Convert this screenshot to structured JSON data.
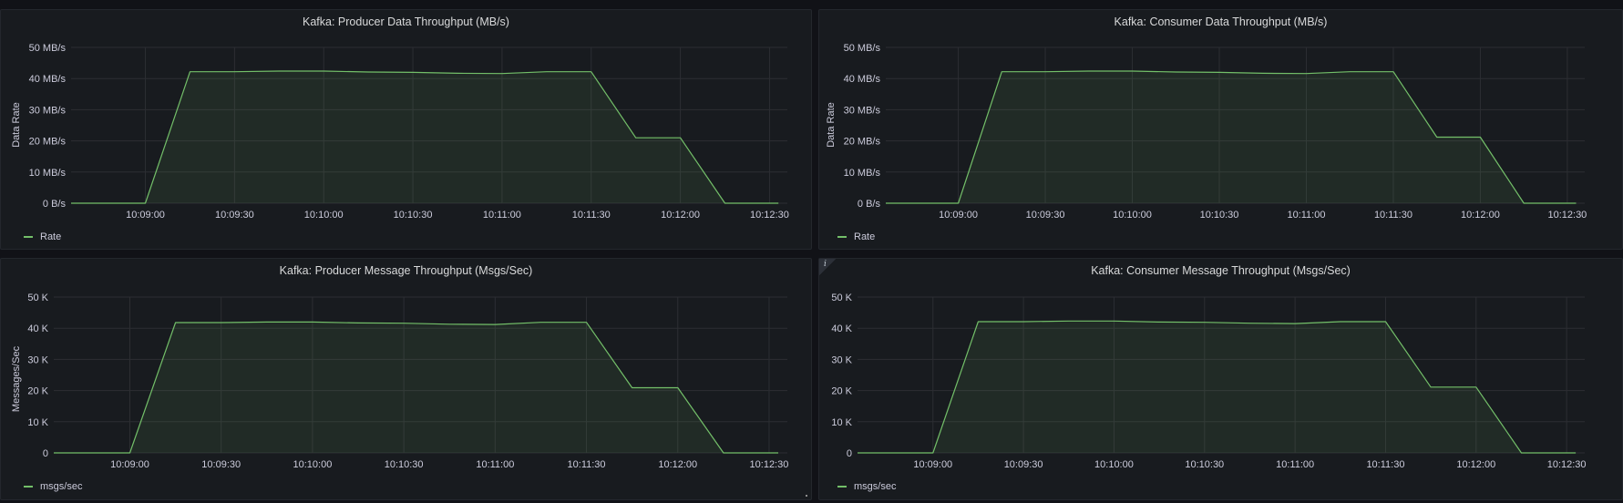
{
  "colors": {
    "series": "#73bf69",
    "fill": "rgba(115,191,105,0.10)",
    "grid": "#2c2e33"
  },
  "panels": [
    {
      "id": "producer-data",
      "title": "Kafka: Producer Data Throughput (MB/s)",
      "ylabel": "Data Rate",
      "legend": "Rate",
      "info_icon": false
    },
    {
      "id": "consumer-data",
      "title": "Kafka: Consumer Data Throughput (MB/s)",
      "ylabel": "Data Rate",
      "legend": "Rate",
      "info_icon": false
    },
    {
      "id": "producer-msgs",
      "title": "Kafka: Producer Message Throughput (Msgs/Sec)",
      "ylabel": "Messages/Sec",
      "legend": "msgs/sec",
      "info_icon": false
    },
    {
      "id": "consumer-msgs",
      "title": "Kafka: Consumer Message Throughput (Msgs/Sec)",
      "ylabel": "",
      "legend": "msgs/sec",
      "info_icon": true,
      "info_label": "i"
    }
  ],
  "chart_data": [
    {
      "type": "area",
      "title": "Kafka: Producer Data Throughput (MB/s)",
      "xlabel": "",
      "ylabel": "Data Rate",
      "x_ticks": [
        "10:09:00",
        "10:09:30",
        "10:10:00",
        "10:10:30",
        "10:11:00",
        "10:11:30",
        "10:12:00",
        "10:12:30"
      ],
      "y_ticks": [
        "0 B/s",
        "10 MB/s",
        "20 MB/s",
        "30 MB/s",
        "40 MB/s",
        "50 MB/s"
      ],
      "ylim": [
        0,
        50
      ],
      "xlim": [
        "10:08:35",
        "10:12:36"
      ],
      "grid": true,
      "legend_position": "bottom-left",
      "series": [
        {
          "name": "Rate",
          "x": [
            "10:08:35",
            "10:08:45",
            "10:08:55",
            "10:09:00",
            "10:09:15",
            "10:09:30",
            "10:09:45",
            "10:10:00",
            "10:10:15",
            "10:10:30",
            "10:10:45",
            "10:11:00",
            "10:11:15",
            "10:11:30",
            "10:11:45",
            "10:12:00",
            "10:12:15",
            "10:12:30",
            "10:12:33"
          ],
          "y": [
            0,
            0,
            0,
            0,
            42.2,
            42.2,
            42.4,
            42.4,
            42.1,
            42.0,
            41.7,
            41.6,
            42.2,
            42.2,
            21.0,
            21.0,
            0,
            0,
            0
          ]
        }
      ]
    },
    {
      "type": "area",
      "title": "Kafka: Consumer Data Throughput (MB/s)",
      "xlabel": "",
      "ylabel": "Data Rate",
      "x_ticks": [
        "10:09:00",
        "10:09:30",
        "10:10:00",
        "10:10:30",
        "10:11:00",
        "10:11:30",
        "10:12:00",
        "10:12:30"
      ],
      "y_ticks": [
        "0 B/s",
        "10 MB/s",
        "20 MB/s",
        "30 MB/s",
        "40 MB/s",
        "50 MB/s"
      ],
      "ylim": [
        0,
        50
      ],
      "xlim": [
        "10:08:35",
        "10:12:36"
      ],
      "grid": true,
      "legend_position": "bottom-left",
      "series": [
        {
          "name": "Rate",
          "x": [
            "10:08:35",
            "10:08:45",
            "10:08:55",
            "10:09:00",
            "10:09:15",
            "10:09:30",
            "10:09:45",
            "10:10:00",
            "10:10:15",
            "10:10:30",
            "10:10:45",
            "10:11:00",
            "10:11:15",
            "10:11:30",
            "10:11:45",
            "10:12:00",
            "10:12:15",
            "10:12:30",
            "10:12:33"
          ],
          "y": [
            0,
            0,
            0,
            0,
            42.2,
            42.2,
            42.4,
            42.4,
            42.1,
            42.0,
            41.7,
            41.6,
            42.2,
            42.2,
            21.2,
            21.2,
            0,
            0,
            0
          ]
        }
      ]
    },
    {
      "type": "area",
      "title": "Kafka: Producer Message Throughput (Msgs/Sec)",
      "xlabel": "",
      "ylabel": "Messages/Sec",
      "x_ticks": [
        "10:09:00",
        "10:09:30",
        "10:10:00",
        "10:10:30",
        "10:11:00",
        "10:11:30",
        "10:12:00",
        "10:12:30"
      ],
      "y_ticks": [
        "0",
        "10 K",
        "20 K",
        "30 K",
        "40 K",
        "50 K"
      ],
      "ylim": [
        0,
        50
      ],
      "xlim": [
        "10:08:35",
        "10:12:36"
      ],
      "grid": true,
      "legend_position": "bottom-left",
      "series": [
        {
          "name": "msgs/sec",
          "x": [
            "10:08:35",
            "10:08:45",
            "10:08:55",
            "10:09:00",
            "10:09:15",
            "10:09:30",
            "10:09:45",
            "10:10:00",
            "10:10:15",
            "10:10:30",
            "10:10:45",
            "10:11:00",
            "10:11:15",
            "10:11:30",
            "10:11:45",
            "10:12:00",
            "10:12:15",
            "10:12:30",
            "10:12:33"
          ],
          "y": [
            0,
            0,
            0,
            0,
            41.8,
            41.8,
            42.0,
            42.0,
            41.7,
            41.6,
            41.3,
            41.2,
            41.9,
            41.9,
            20.9,
            20.9,
            0,
            0,
            0
          ]
        }
      ]
    },
    {
      "type": "area",
      "title": "Kafka: Consumer Message Throughput (Msgs/Sec)",
      "xlabel": "",
      "ylabel": "",
      "x_ticks": [
        "10:09:00",
        "10:09:30",
        "10:10:00",
        "10:10:30",
        "10:11:00",
        "10:11:30",
        "10:12:00",
        "10:12:30"
      ],
      "y_ticks": [
        "0",
        "10 K",
        "20 K",
        "30 K",
        "40 K",
        "50 K"
      ],
      "ylim": [
        0,
        50
      ],
      "xlim": [
        "10:08:35",
        "10:12:36"
      ],
      "grid": true,
      "legend_position": "bottom-left",
      "series": [
        {
          "name": "msgs/sec",
          "x": [
            "10:08:35",
            "10:08:45",
            "10:08:55",
            "10:09:00",
            "10:09:15",
            "10:09:30",
            "10:09:45",
            "10:10:00",
            "10:10:15",
            "10:10:30",
            "10:10:45",
            "10:11:00",
            "10:11:15",
            "10:11:30",
            "10:11:45",
            "10:12:00",
            "10:12:15",
            "10:12:30",
            "10:12:33"
          ],
          "y": [
            0,
            0,
            0,
            0,
            42.1,
            42.1,
            42.3,
            42.3,
            42.0,
            41.9,
            41.6,
            41.5,
            42.1,
            42.1,
            21.1,
            21.1,
            0,
            0,
            0
          ]
        }
      ]
    }
  ]
}
